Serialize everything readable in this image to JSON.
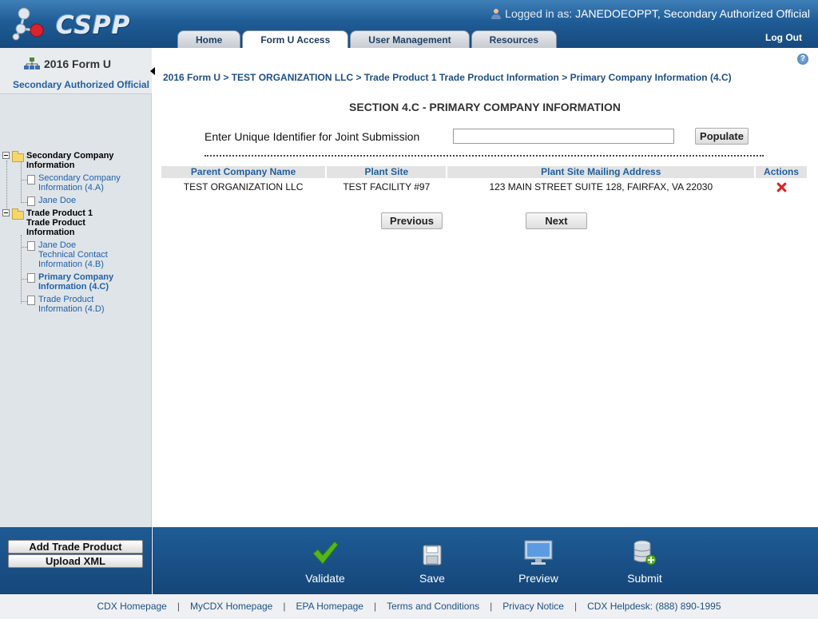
{
  "header": {
    "logo_text": "CSPP",
    "login_label": "Logged in as:",
    "login_user": "JANEDOEOPPT, Secondary Authorized Official",
    "logout": "Log Out",
    "tabs": [
      {
        "label": "Home",
        "active": false
      },
      {
        "label": "Form U Access",
        "active": true
      },
      {
        "label": "User Management",
        "active": false
      },
      {
        "label": "Resources",
        "active": false
      }
    ]
  },
  "sidebar": {
    "title": "2016 Form U",
    "role": "Secondary Authorized Official",
    "tree": {
      "folder1": {
        "line1": "Secondary Company",
        "line2": "Information"
      },
      "item_4a": {
        "line1": "Secondary Company",
        "line2": "Information (4.A)"
      },
      "item_jane1": "Jane Doe",
      "folder2": {
        "line1": "Trade Product 1",
        "line2": "Trade Product",
        "line3": "Information"
      },
      "item_4b": {
        "line1": "Jane Doe",
        "line2": "Technical Contact",
        "line3": "Information (4.B)"
      },
      "item_4c": {
        "line1": "Primary Company",
        "line2": "Information (4.C)"
      },
      "item_4d": {
        "line1": "Trade Product",
        "line2": "Information (4.D)"
      }
    }
  },
  "breadcrumb": {
    "crumbs": [
      "2016 Form U",
      "TEST ORGANIZATION LLC",
      "Trade Product 1 Trade Product Information",
      "Primary Company Information (4.C)"
    ],
    "separator": " > "
  },
  "main": {
    "section_title": "SECTION 4.C - PRIMARY COMPANY INFORMATION",
    "uid_label": "Enter Unique Identifier for Joint Submission",
    "uid_value": "",
    "populate": "Populate",
    "table": {
      "headers": [
        "Parent Company Name",
        "Plant Site",
        "Plant Site Mailing Address",
        "Actions"
      ],
      "rows": [
        {
          "parent": "TEST ORGANIZATION LLC",
          "plant": "TEST FACILITY #97",
          "address": "123 MAIN STREET SUITE 128, FAIRFAX, VA 22030",
          "action": "delete-icon"
        }
      ]
    },
    "previous": "Previous",
    "next": "Next"
  },
  "toolbar": {
    "add_trade_product": "Add Trade Product",
    "upload_xml": "Upload XML",
    "validate": "Validate",
    "save": "Save",
    "preview": "Preview",
    "submit": "Submit"
  },
  "footer": {
    "links": [
      "CDX Homepage",
      "MyCDX Homepage",
      "EPA Homepage",
      "Terms and Conditions",
      "Privacy Notice",
      "CDX Helpdesk: (888) 890-1995"
    ]
  },
  "colors": {
    "header_blue": "#1f5c96",
    "link_blue": "#1f5f9e",
    "delete_red": "#e02020",
    "validate_green": "#4caf1a"
  }
}
